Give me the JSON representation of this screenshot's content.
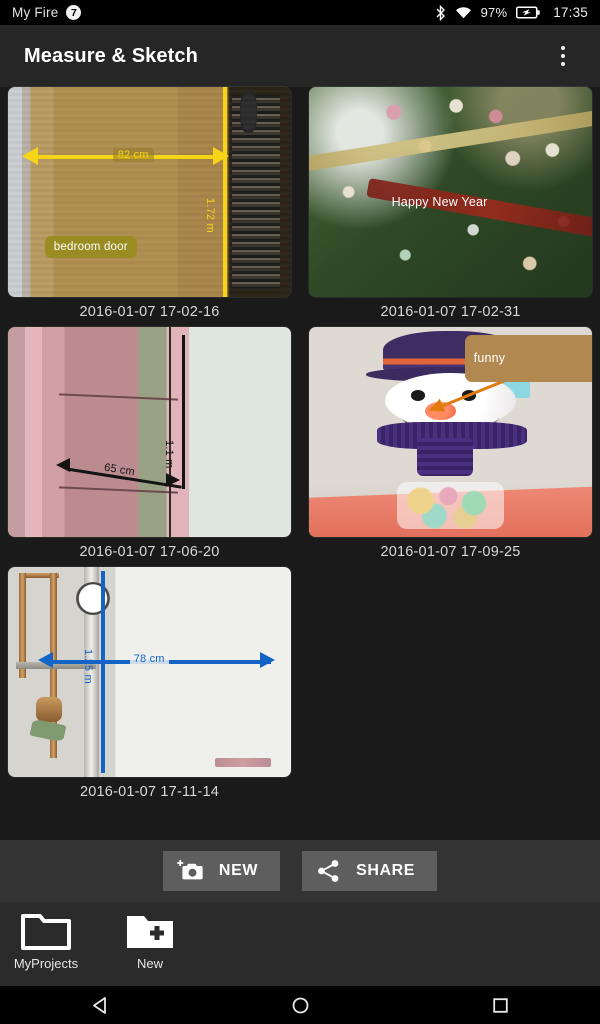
{
  "statusbar": {
    "device_name": "My Fire",
    "device_badge": "7",
    "bluetooth_icon": "bluetooth-icon",
    "wifi_icon": "wifi-icon",
    "battery_percent": "97%",
    "battery_icon": "battery-charging-icon",
    "time": "17:35"
  },
  "appbar": {
    "title": "Measure & Sketch",
    "overflow_icon": "overflow-menu-icon",
    "background": "#262626"
  },
  "gallery": {
    "items": [
      {
        "caption": "2016-01-07 17-02-16",
        "subject": "wooden bedroom door",
        "annotation_color": "#f5d516",
        "text_label": "bedroom door",
        "text_label_color": "#9a8c22",
        "measurements": [
          {
            "value": "82 cm",
            "orientation": "horizontal"
          },
          {
            "value": "1.72 m",
            "orientation": "vertical"
          }
        ]
      },
      {
        "caption": "2016-01-07 17-02-31",
        "subject": "christmas tree",
        "annotation_color": "#ffffff",
        "text_label": "Happy New Year",
        "text_label_color": "#7d1f18",
        "measurements": []
      },
      {
        "caption": "2016-01-07 17-06-20",
        "subject": "pink door",
        "annotation_color": "#111111",
        "text_label": "",
        "text_label_color": "",
        "measurements": [
          {
            "value": "65 cm",
            "orientation": "horizontal"
          },
          {
            "value": "1.1 m",
            "orientation": "vertical"
          }
        ]
      },
      {
        "caption": "2016-01-07 17-09-25",
        "subject": "snowman figurine",
        "annotation_color": "#e07b10",
        "text_label": "funny",
        "text_label_color": "#b08850",
        "measurements": []
      },
      {
        "caption": "2016-01-07 17-11-14",
        "subject": "plumbing pipes",
        "annotation_color": "#1464c8",
        "text_label": "",
        "text_label_color": "",
        "measurements": [
          {
            "value": "78 cm",
            "orientation": "horizontal"
          },
          {
            "value": "1.25 m",
            "orientation": "vertical"
          }
        ]
      }
    ]
  },
  "actionbar": {
    "new_label": "NEW",
    "new_icon": "camera-add-icon",
    "share_label": "SHARE",
    "share_icon": "share-icon"
  },
  "dock": {
    "items": [
      {
        "label": "MyProjects",
        "icon": "folder-icon"
      },
      {
        "label": "New",
        "icon": "folder-add-icon"
      }
    ]
  },
  "navbar": {
    "back_icon": "back-triangle-icon",
    "home_icon": "home-circle-icon",
    "recents_icon": "recents-square-icon"
  }
}
